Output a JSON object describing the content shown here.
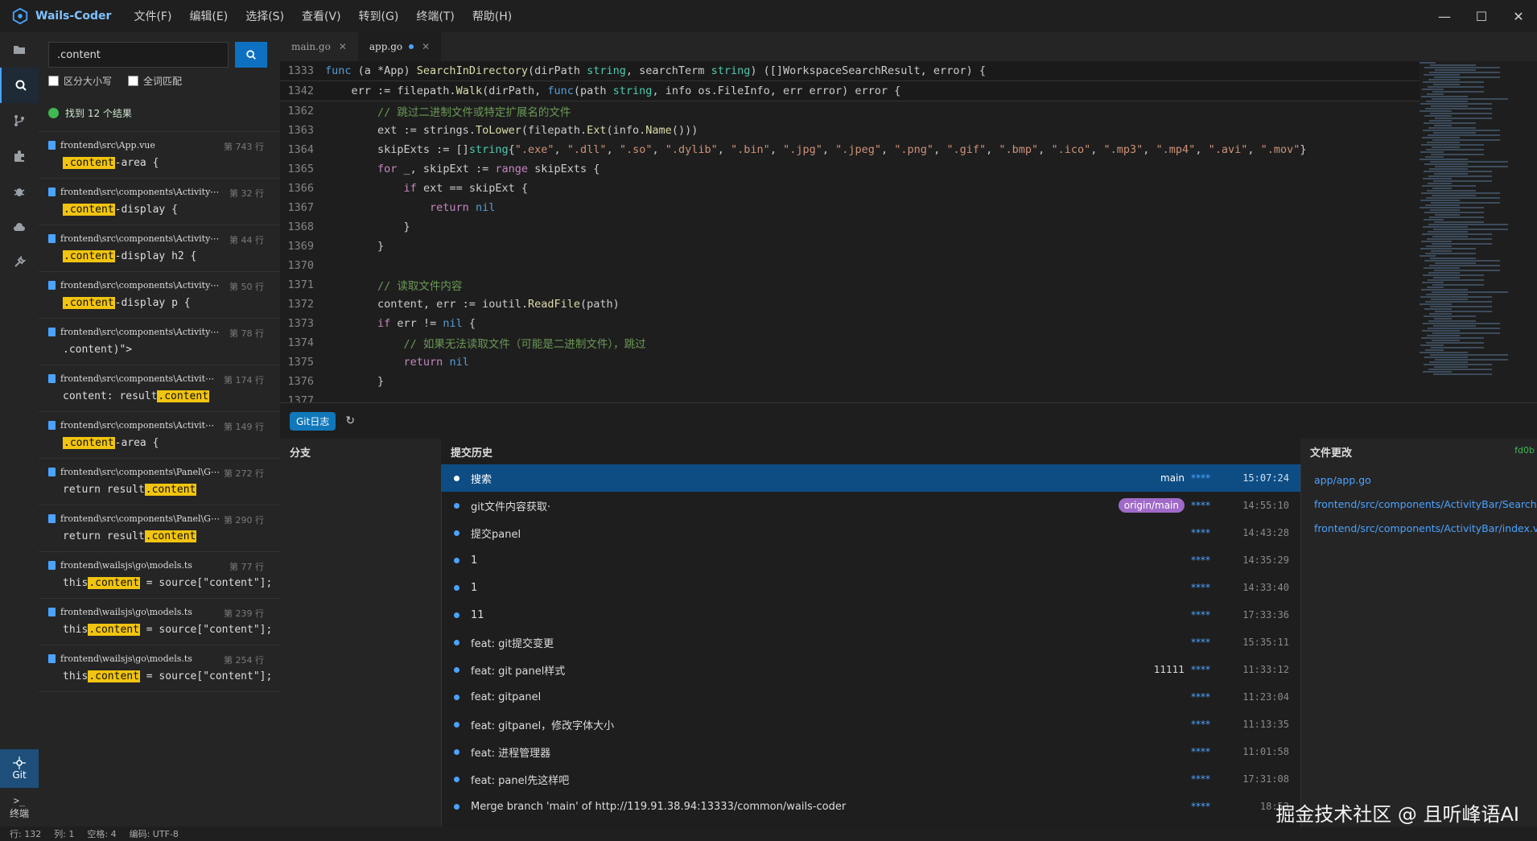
{
  "app": {
    "name": "Wails-Coder"
  },
  "menu": [
    "文件(F)",
    "编辑(E)",
    "选择(S)",
    "查看(V)",
    "转到(G)",
    "终端(T)",
    "帮助(H)"
  ],
  "window_controls": {
    "minimize": "—",
    "maximize": "☐",
    "close": "✕"
  },
  "activitybar": {
    "git_label": "Git",
    "terminal_label": "终端"
  },
  "search": {
    "query": ".content",
    "case_label": "区分大小写",
    "word_label": "全词匹配",
    "summary": "找到 12 个结果",
    "results": [
      {
        "file": "frontend\\src\\App.vue",
        "line": "第 743 行",
        "before": "",
        "match": ".content",
        "after": "-area {"
      },
      {
        "file": "frontend\\src\\components\\Activity⋯",
        "line": "第 32 行",
        "before": "",
        "match": ".content",
        "after": "-display {"
      },
      {
        "file": "frontend\\src\\components\\Activity⋯",
        "line": "第 44 行",
        "before": "",
        "match": ".content",
        "after": "-display h2 {"
      },
      {
        "file": "frontend\\src\\components\\Activity⋯",
        "line": "第 50 行",
        "before": "",
        "match": ".content",
        "after": "-display p {"
      },
      {
        "file": "frontend\\src\\components\\Activity⋯",
        "line": "第 78 行",
        "before": ".content)\">",
        "match": "",
        "after": ""
      },
      {
        "file": "frontend\\src\\components\\Activit⋯",
        "line": "第 174 行",
        "before": "content: result",
        "match": ".content",
        "after": ""
      },
      {
        "file": "frontend\\src\\components\\Activit⋯",
        "line": "第 149 行",
        "before": "",
        "match": ".content",
        "after": "-area {"
      },
      {
        "file": "frontend\\src\\components\\Panel\\G⋯",
        "line": "第 272 行",
        "before": "return result",
        "match": ".content",
        "after": ""
      },
      {
        "file": "frontend\\src\\components\\Panel\\G⋯",
        "line": "第 290 行",
        "before": "return result",
        "match": ".content",
        "after": ""
      },
      {
        "file": "frontend\\wailsjs\\go\\models.ts",
        "line": "第 77 行",
        "before": "this",
        "match": ".content",
        "after": " = source[\"content\"];"
      },
      {
        "file": "frontend\\wailsjs\\go\\models.ts",
        "line": "第 239 行",
        "before": "this",
        "match": ".content",
        "after": " = source[\"content\"];"
      },
      {
        "file": "frontend\\wailsjs\\go\\models.ts",
        "line": "第 254 行",
        "before": "this",
        "match": ".content",
        "after": " = source[\"content\"];"
      }
    ]
  },
  "tabs": [
    {
      "name": "main.go",
      "active": false,
      "modified": false,
      "close": "✕"
    },
    {
      "name": "app.go",
      "active": true,
      "modified": true,
      "close": "✕"
    }
  ],
  "code": [
    {
      "n": "1333",
      "html": "<span class=\"kw\">func</span> (a *App) <span class=\"fn\">SearchInDirectory</span>(dirPath <span class=\"ty\">string</span>, searchTerm <span class=\"ty\">string</span>) ([]WorkspaceSearchResult, error) {",
      "sticky": true
    },
    {
      "n": "1342",
      "html": "    err := filepath.<span class=\"fn\">Walk</span>(dirPath, <span class=\"kw\">func</span>(path <span class=\"ty\">string</span>, info os.FileInfo, err error) error {",
      "sticky": true
    },
    {
      "n": "1362",
      "html": "        <span class=\"cm\">// 跳过二进制文件或特定扩展名的文件</span>"
    },
    {
      "n": "1363",
      "html": "        ext := strings.<span class=\"fn\">ToLower</span>(filepath.<span class=\"fn\">Ext</span>(info.<span class=\"fn\">Name</span>()))"
    },
    {
      "n": "1364",
      "html": "        skipExts := []<span class=\"ty\">string</span>{<span class=\"str\">\".exe\"</span>, <span class=\"str\">\".dll\"</span>, <span class=\"str\">\".so\"</span>, <span class=\"str\">\".dylib\"</span>, <span class=\"str\">\".bin\"</span>, <span class=\"str\">\".jpg\"</span>, <span class=\"str\">\".jpeg\"</span>, <span class=\"str\">\".png\"</span>, <span class=\"str\">\".gif\"</span>, <span class=\"str\">\".bmp\"</span>, <span class=\"str\">\".ico\"</span>, <span class=\"str\">\".mp3\"</span>, <span class=\"str\">\".mp4\"</span>, <span class=\"str\">\".avi\"</span>, <span class=\"str\">\".mov\"</span>}"
    },
    {
      "n": "1365",
      "html": "        <span class=\"kw2\">for</span> _, skipExt := <span class=\"kw2\">range</span> skipExts {"
    },
    {
      "n": "1366",
      "html": "            <span class=\"kw2\">if</span> ext == skipExt {"
    },
    {
      "n": "1367",
      "html": "                <span class=\"kw2\">return</span> <span class=\"kw\">nil</span>"
    },
    {
      "n": "1368",
      "html": "            }"
    },
    {
      "n": "1369",
      "html": "        }"
    },
    {
      "n": "1370",
      "html": ""
    },
    {
      "n": "1371",
      "html": "        <span class=\"cm\">// 读取文件内容</span>"
    },
    {
      "n": "1372",
      "html": "        content, err := ioutil.<span class=\"fn\">ReadFile</span>(path)"
    },
    {
      "n": "1373",
      "html": "        <span class=\"kw2\">if</span> err != <span class=\"kw\">nil</span> {"
    },
    {
      "n": "1374",
      "html": "            <span class=\"cm\">// 如果无法读取文件（可能是二进制文件），跳过</span>"
    },
    {
      "n": "1375",
      "html": "            <span class=\"kw2\">return</span> <span class=\"kw\">nil</span>"
    },
    {
      "n": "1376",
      "html": "        }"
    },
    {
      "n": "1377",
      "html": ""
    }
  ],
  "panel": {
    "git_tab": "Git日志",
    "refresh": "↻",
    "branch_header": "分支",
    "history_header": "提交历史",
    "files_header": "文件更改",
    "hash": "fd0b",
    "commits": [
      {
        "msg": "搜索",
        "ref": "main",
        "ref_style": "plain",
        "stars": "****",
        "time": "15:07:24",
        "selected": true
      },
      {
        "msg": "git文件内容获取·",
        "ref": "origin/main",
        "ref_style": "pill",
        "stars": "****",
        "time": "14:55:10"
      },
      {
        "msg": "提交panel",
        "ref": "",
        "stars": "****",
        "time": "14:43:28"
      },
      {
        "msg": "1",
        "ref": "",
        "stars": "****",
        "time": "14:35:29"
      },
      {
        "msg": "1",
        "ref": "",
        "stars": "****",
        "time": "14:33:40"
      },
      {
        "msg": "11",
        "ref": "",
        "stars": "****",
        "time": "17:33:36"
      },
      {
        "msg": "feat: git提交变更",
        "ref": "",
        "stars": "****",
        "time": "15:35:11"
      },
      {
        "msg": "feat: git panel样式",
        "ref": "11111",
        "ref_style": "plain",
        "stars": "****",
        "time": "11:33:12"
      },
      {
        "msg": "feat: gitpanel",
        "ref": "",
        "stars": "****",
        "time": "11:23:04"
      },
      {
        "msg": "feat: gitpanel，修改字体大小",
        "ref": "",
        "stars": "****",
        "time": "11:13:35"
      },
      {
        "msg": "feat: 进程管理器",
        "ref": "",
        "stars": "****",
        "time": "11:01:58"
      },
      {
        "msg": "feat: panel先这样吧",
        "ref": "",
        "stars": "****",
        "time": "17:31:08"
      },
      {
        "msg": "Merge branch 'main' of http://119.91.38.94:13333/common/wails-coder",
        "ref": "",
        "stars": "****",
        "time": "18:53"
      }
    ],
    "changed_files": [
      "app/app.go",
      "frontend/src/components/ActivityBar/SearchView",
      "frontend/src/components/ActivityBar/index.vue"
    ]
  },
  "status": [
    "行: 132",
    "列: 1",
    "空格: 4",
    "编码: UTF-8"
  ],
  "watermark": "掘金技术社区 @ 且听峰语AI",
  "colors": {
    "accent": "#0e70c0",
    "highlight": "#f1c40f",
    "selected": "#0e4d84",
    "pill": "#a06ac8"
  }
}
